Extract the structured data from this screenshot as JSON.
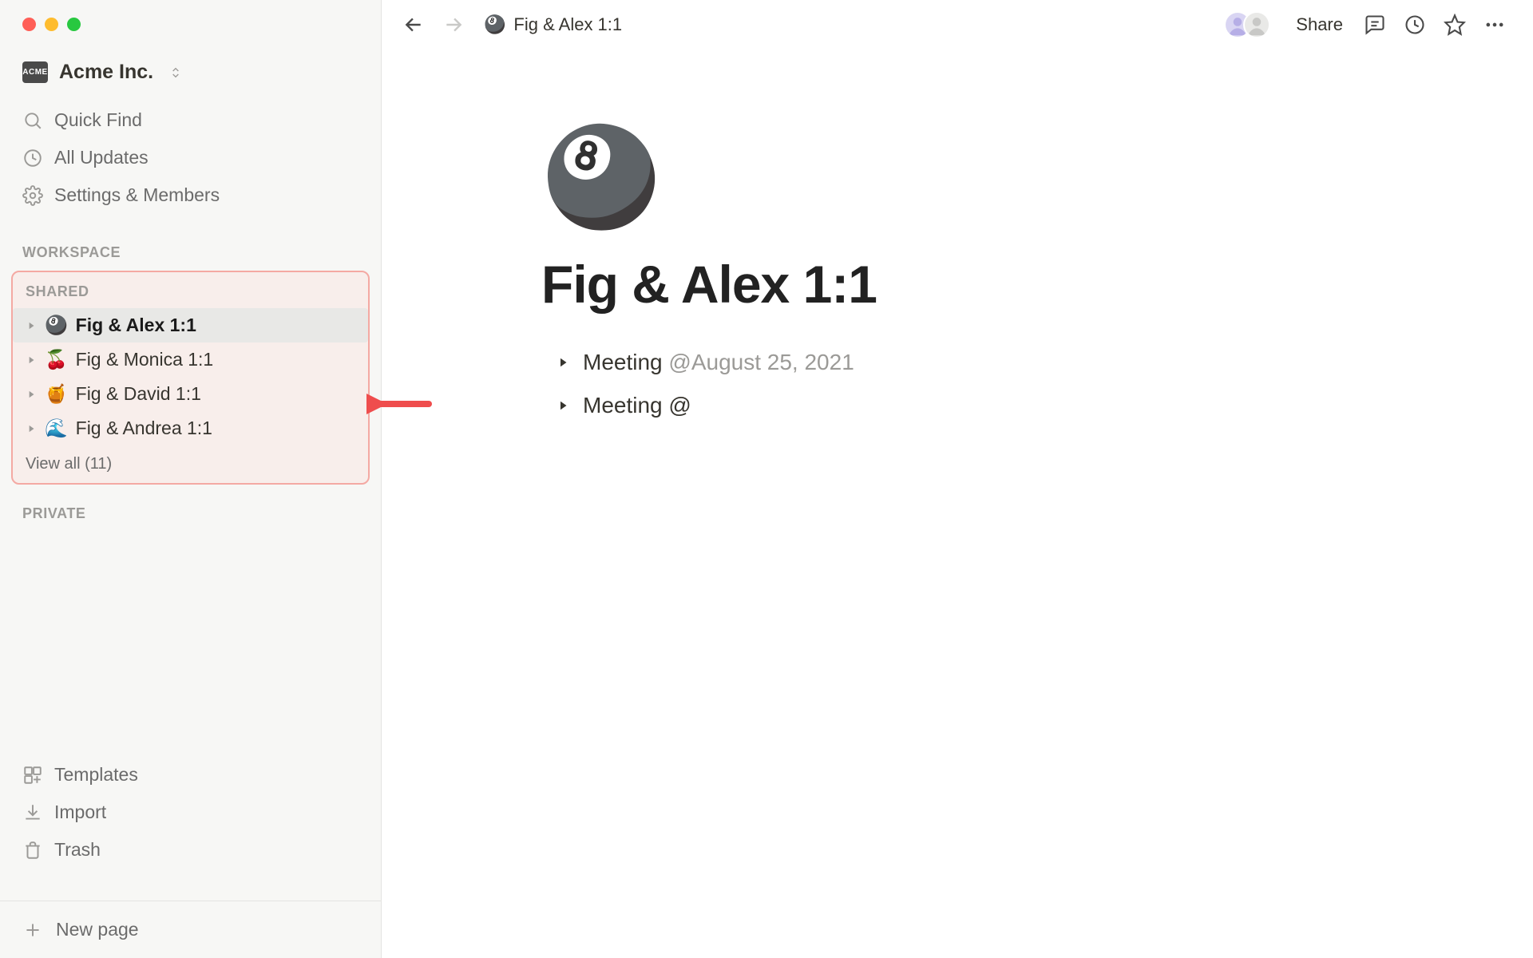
{
  "workspace": {
    "name": "Acme Inc.",
    "badge": "ACME"
  },
  "sidebar": {
    "quick_find": "Quick Find",
    "all_updates": "All Updates",
    "settings": "Settings & Members",
    "section_workspace": "WORKSPACE",
    "section_shared": "SHARED",
    "section_private": "PRIVATE",
    "shared_items": [
      {
        "emoji": "🎱",
        "label": "Fig & Alex 1:1",
        "selected": true
      },
      {
        "emoji": "🍒",
        "label": "Fig & Monica 1:1",
        "selected": false
      },
      {
        "emoji": "🍯",
        "label": "Fig & David 1:1",
        "selected": false
      },
      {
        "emoji": "🌊",
        "label": "Fig & Andrea 1:1",
        "selected": false
      }
    ],
    "view_all_prefix": "View all ",
    "view_all_count": "(11)",
    "templates": "Templates",
    "import": "Import",
    "trash": "Trash",
    "new_page": "New page"
  },
  "topbar": {
    "breadcrumb_emoji": "🎱",
    "breadcrumb_title": "Fig & Alex 1:1",
    "share": "Share"
  },
  "page": {
    "hero_emoji": "🎱",
    "title": "Fig & Alex 1:1",
    "toggles": [
      {
        "label": "Meeting ",
        "mention": "@August 25, 2021"
      },
      {
        "label": "Meeting @",
        "mention": ""
      }
    ]
  },
  "annotation": {
    "arrow_color": "#ef4d4d"
  }
}
